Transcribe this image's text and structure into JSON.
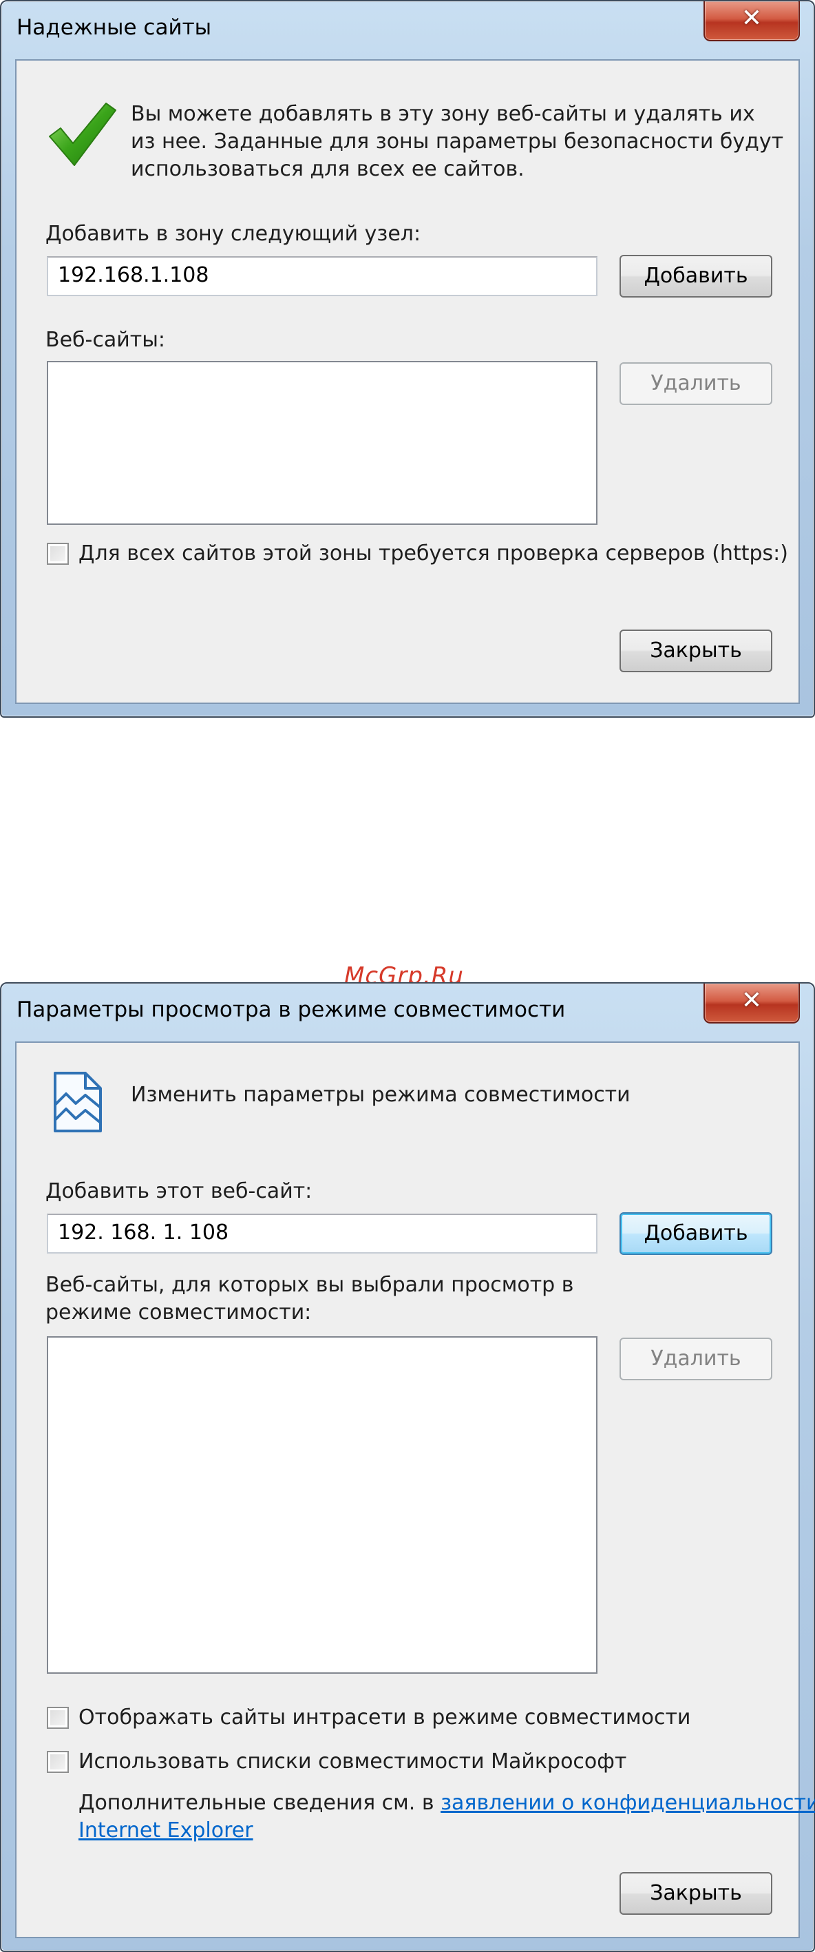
{
  "trusted_sites_dialog": {
    "title": "Надежные сайты",
    "close_glyph": "✕",
    "icon": "green-checkmark-icon",
    "description_lines": [
      "Вы можете добавлять в эту зону  веб-сайты и удалять их",
      "из нее. Заданные для зоны параметры безопасности будут",
      "использоваться для всех ее сайтов."
    ],
    "add_label": "Добавить в зону следующий узел:",
    "add_value": "192.168.1.108",
    "add_button": "Добавить",
    "sites_label": "Веб-сайты:",
    "sites": [],
    "remove_button": "Удалить",
    "https_checkbox": {
      "label": "Для всех сайтов этой зоны требуется проверка серверов (https:)",
      "checked": false
    },
    "close_button": "Закрыть"
  },
  "watermark": "McGrp.Ru",
  "compat_view_dialog": {
    "title": "Параметры просмотра в режиме совместимости",
    "close_glyph": "✕",
    "icon": "broken-page-icon",
    "heading": "Изменить параметры режима совместимости",
    "add_label": "Добавить этот веб-сайт:",
    "add_value": "192. 168. 1. 108",
    "add_button": "Добавить",
    "sites_label_lines": [
      "Веб-сайты, для которых вы выбрали просмотр в",
      "режиме совместимости:"
    ],
    "sites": [],
    "remove_button": "Удалить",
    "intranet_checkbox": {
      "label": "Отображать сайты интрасети в режиме совместимости",
      "checked": false
    },
    "ms_lists_checkbox": {
      "label": "Использовать списки совместимости Майкрософт",
      "checked": false
    },
    "info_prefix": "Дополнительные сведения см. в ",
    "info_link_line1": "заявлении о конфиденциальности",
    "info_link_line2": "Internet Explorer",
    "close_button": "Закрыть"
  },
  "colors": {
    "title_bar": "#b4cde6",
    "close_button_red": "#c7432b",
    "dialog_background": "#efefef",
    "checkmark_green": "#3aa41a",
    "link_blue": "#0066cc",
    "watermark_red": "#d63a2a",
    "default_button_border": "#3c7fb1"
  }
}
